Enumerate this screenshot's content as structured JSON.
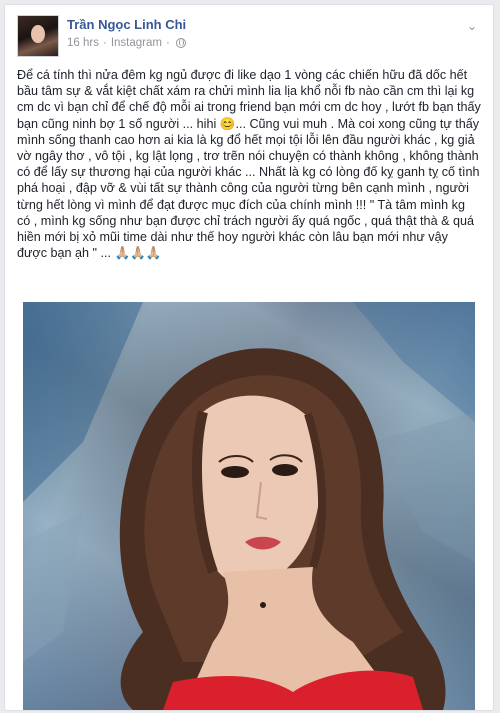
{
  "post": {
    "author": "Trần Ngọc Linh Chi",
    "time": "16 hrs",
    "separator": "·",
    "source": "Instagram",
    "privacy_icon": "globe-icon",
    "options_icon": "chevron-down-icon",
    "text": "Để cá tính thì nửa đêm kg ngủ được đi like dạo 1 vòng các chiến hữu đã dốc hết bầu tâm sự & vắt kiệt chất xám ra chửi mình lia lịa khổ nỗi fb nào cần cm thì lại kg cm dc vì bạn chỉ để chế độ mỗi ai trong friend bạn mới cm dc hoy , lướt fb bạn thấy bạn cũng ninh bợ 1 số người ... hihi 😊... Cũng vui muh . Mà coi xong cũng tự thấy mình sống thanh cao hơn ai kia là kg đổ hết mọi tội lỗi lên đầu người khác , kg giả vờ ngây thơ , vô tội , kg lật lọng , trơ trẽn nói chuyện có thành không , không thành có để lấy sự thương hại của người khác ... Nhất là kg có lòng đố kỵ ganh tỵ cố tình phá hoại , đập vỡ & vùi tất sự thành công của người từng bên cạnh mình , người từng hết lòng vì mình để đạt được mục đích của chính mình !!! \" Tà tâm mình kg có , mình kg sống như bạn được chỉ trách người ấy quá ngốc , quá thật thà & quá hiền mới bị xỏ mũi time dài như thế hoy người khác còn lâu bạn mới như vậy được bạn ạh \" ... 🙏🏼🙏🏼🙏🏼"
  },
  "colors": {
    "author_link": "#365899",
    "meta_text": "#90949c",
    "body_text": "#1d2129",
    "page_bg": "#e9ebee",
    "accent_red": "#d9202c"
  }
}
